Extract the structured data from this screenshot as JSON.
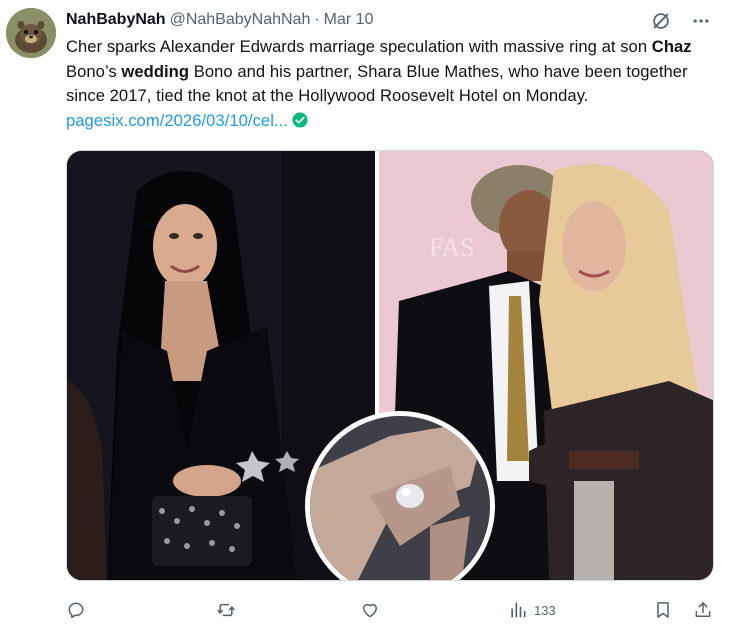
{
  "author": {
    "display_name": "NahBabyNah",
    "handle": "@NahBabyNahNah",
    "separator": "·",
    "date": "Mar 10",
    "avatar_icon": "animal-avatar-icon"
  },
  "header_actions": {
    "grok_icon": "grok-slash-icon",
    "more_icon": "more-horizontal-icon"
  },
  "tweet": {
    "text_part1": "Cher sparks Alexander Edwards marriage speculation with massive ring at son ",
    "bold1": "Chaz",
    "text_part2": " Bono’s ",
    "bold2": "wedding",
    "text_part3": " Bono and his partner, Shara Blue Mathes, who have been together since 2017, tied the knot at the Hollywood Roosevelt Hotel on Monday. ",
    "link": "pagesix.com/2026/03/10/cel...",
    "verified_icon": "verified-check-icon"
  },
  "media": {
    "left_photo": "photo-woman-at-event",
    "right_photo": "photo-couple-kiss",
    "zoom_detail": "ring-closeup"
  },
  "actions": {
    "reply_icon": "reply-icon",
    "retweet_icon": "retweet-icon",
    "like_icon": "heart-icon",
    "views_icon": "views-chart-icon",
    "views_count": "133",
    "bookmark_icon": "bookmark-icon",
    "share_icon": "share-icon"
  },
  "colors": {
    "link": "#1d9bf0",
    "verified": "#00ba7c",
    "muted": "#536471",
    "text": "#0f1419"
  }
}
